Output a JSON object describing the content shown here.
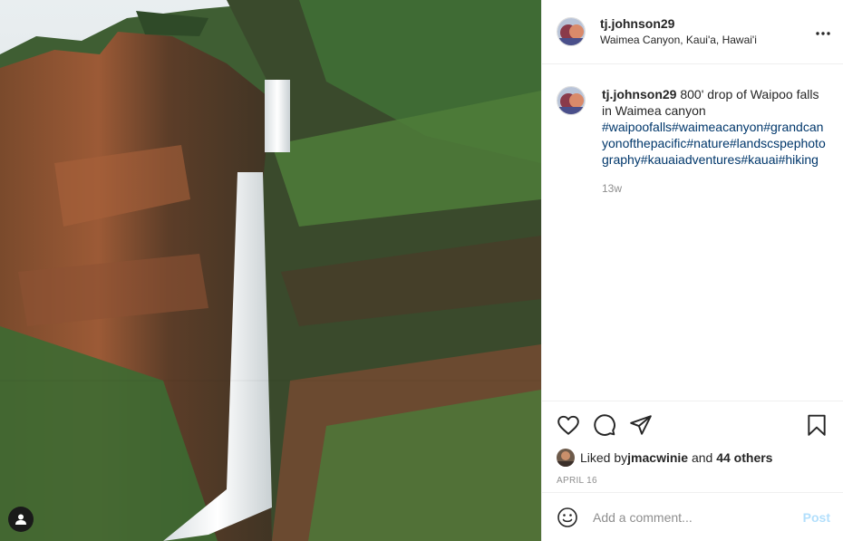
{
  "post": {
    "username": "tj.johnson29",
    "location": "Waimea Canyon, Kaui'a, Hawai'i",
    "more_icon": "more-horizontal-icon",
    "caption": {
      "username": "tj.johnson29",
      "text": "800' drop of Waipoo falls in Waimea canyon",
      "hashtags": "#waipoofalls#waimeacanyon#grandcanyonofthepacific#nature#landscspephotography#kauaiadventures#kauai#hiking",
      "age": "13w"
    },
    "actions": {
      "like_icon": "heart-icon",
      "comment_icon": "comment-icon",
      "share_icon": "paper-plane-icon",
      "save_icon": "bookmark-icon"
    },
    "likes": {
      "prefix": "Liked by ",
      "liker": "jmacwinie",
      "middle": " and ",
      "others": "44 others"
    },
    "date": "APRIL 16",
    "comment_box": {
      "emoji_icon": "smiley-icon",
      "placeholder": "Add a comment...",
      "post_label": "Post"
    },
    "tag_icon": "user-tag-icon",
    "colors": {
      "link": "#00376b",
      "post_disabled": "#b2dffc",
      "muted": "#8e8e8e"
    }
  }
}
